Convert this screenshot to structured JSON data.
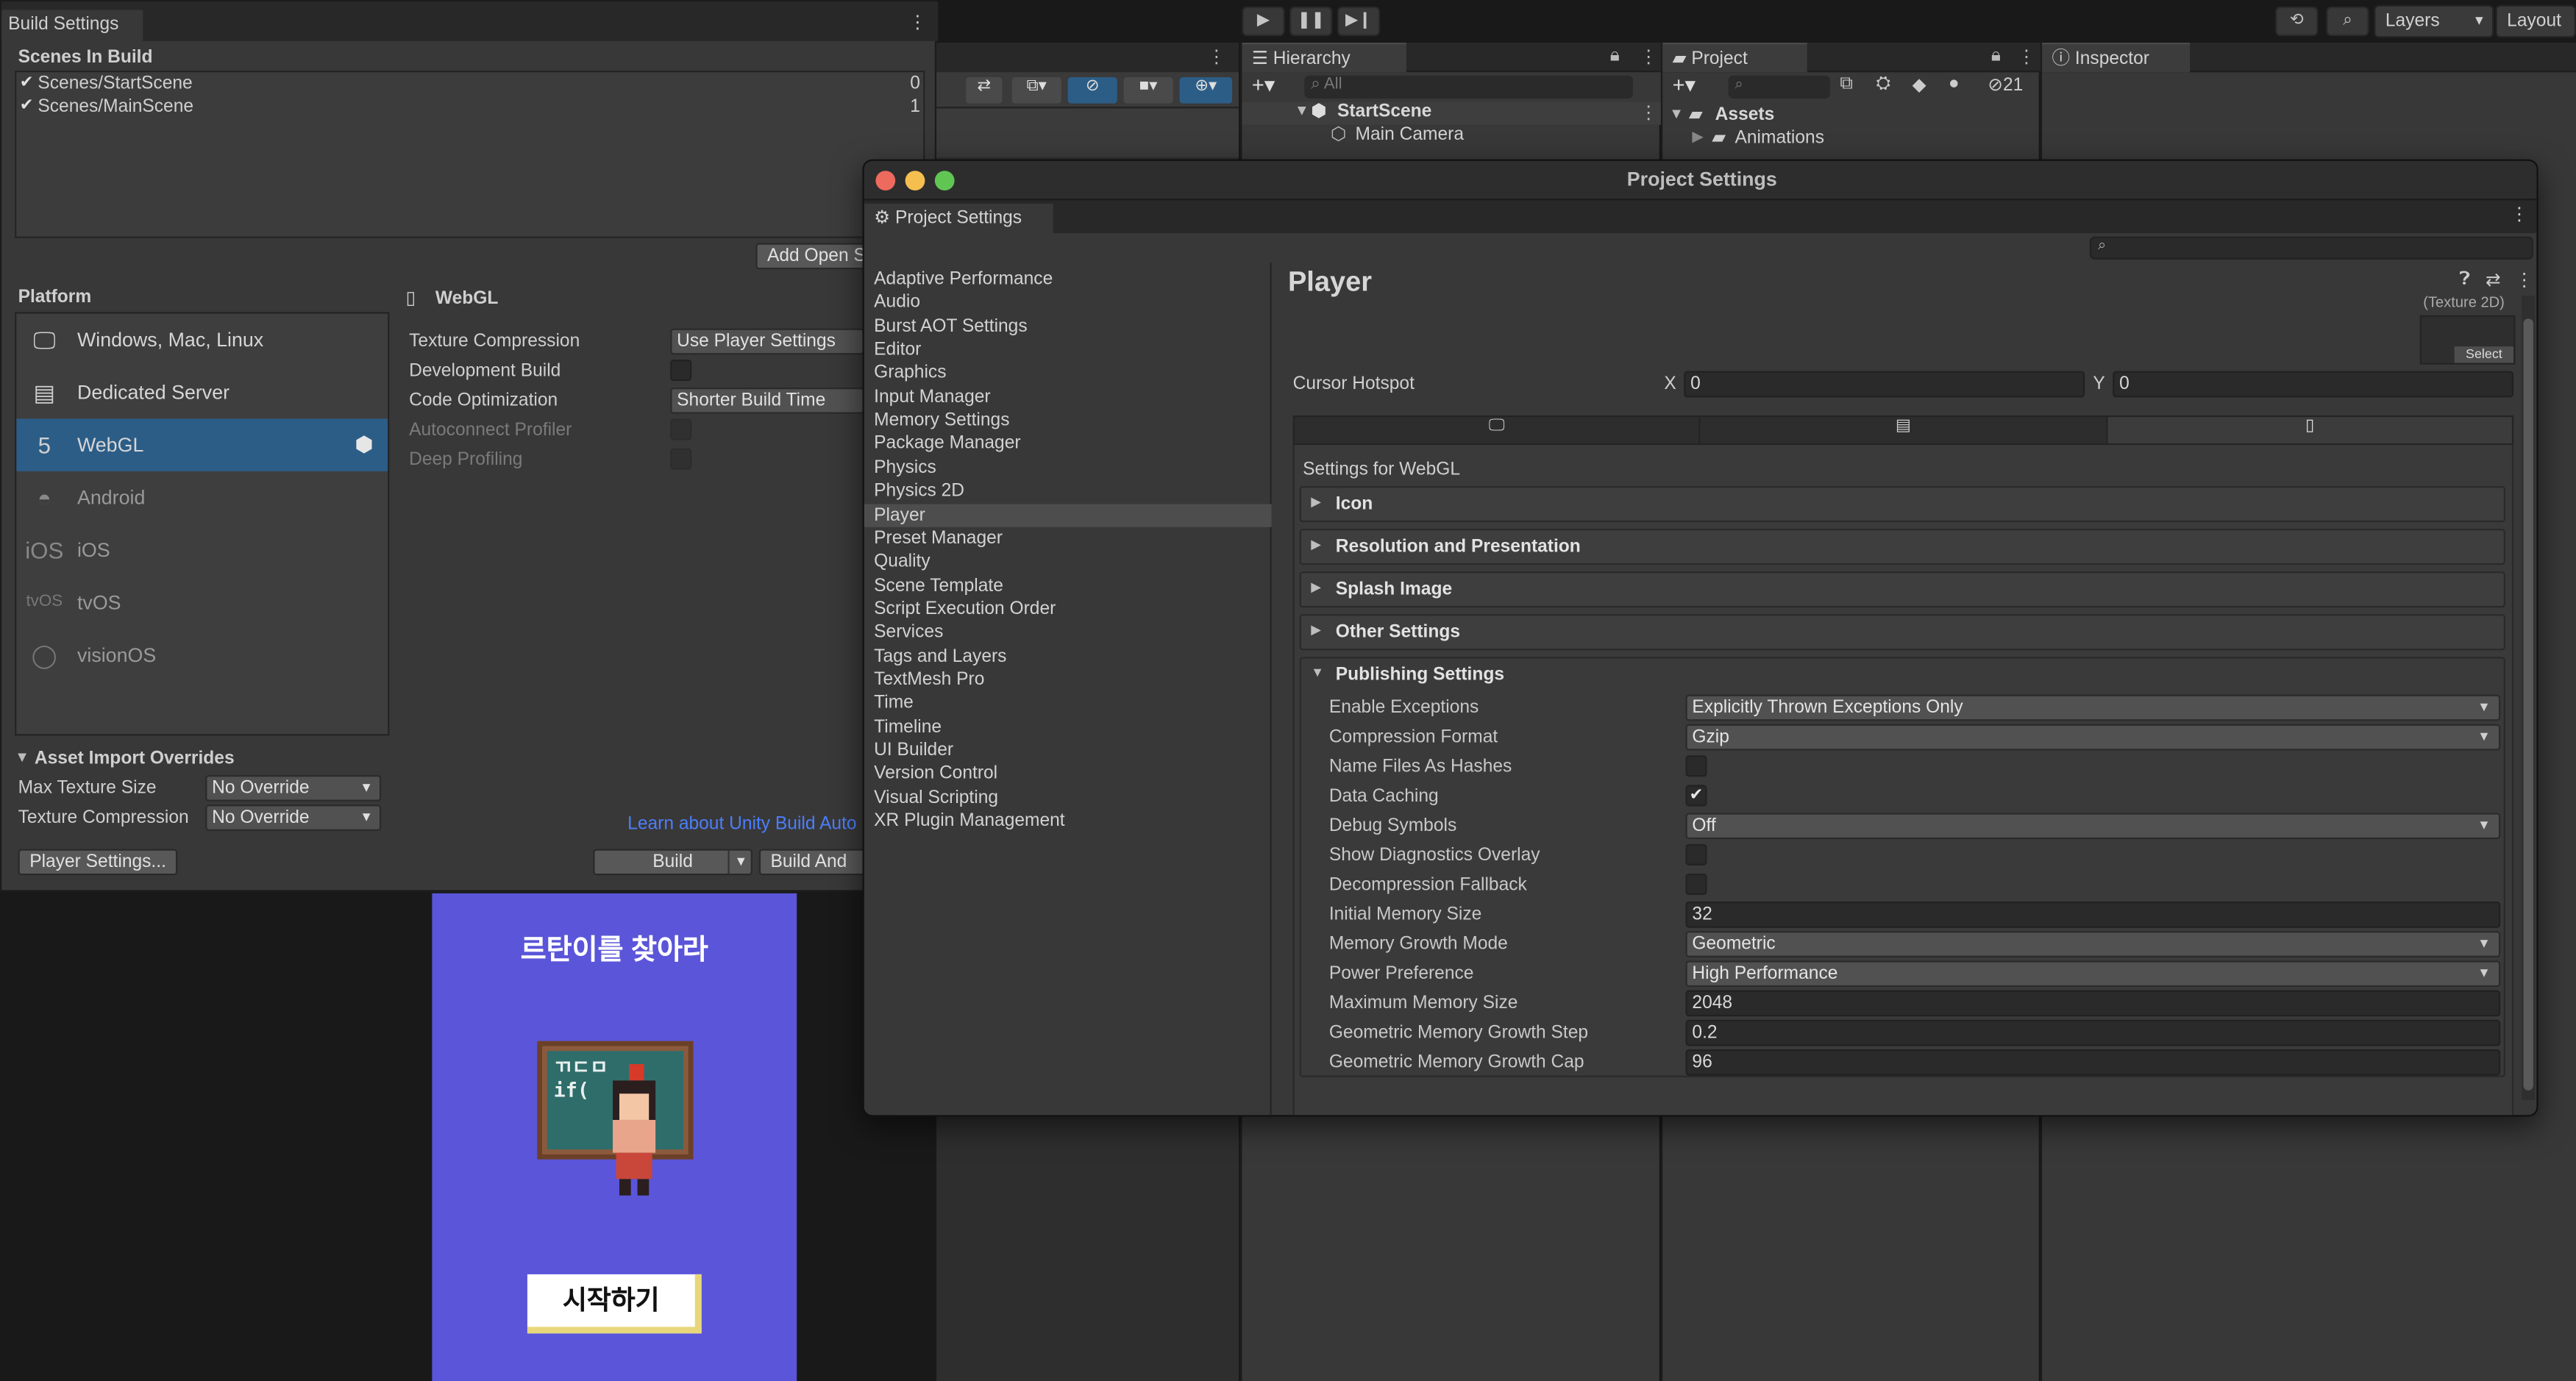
{
  "toolbar": {
    "layers_label": "Layers",
    "layout_label": "Layout"
  },
  "hierarchy": {
    "tab_label": "Hierarchy",
    "search_placeholder": "All",
    "scene_name": "StartScene",
    "items": [
      "Main Camera"
    ]
  },
  "project": {
    "tab_label": "Project",
    "hidden_count": "21",
    "assets_label": "Assets",
    "folders": [
      "Animations"
    ]
  },
  "inspector": {
    "tab_label": "Inspector"
  },
  "build_settings": {
    "tab_label": "Build Settings",
    "scenes_header": "Scenes In Build",
    "scenes": [
      {
        "name": "Scenes/StartScene",
        "index": "0"
      },
      {
        "name": "Scenes/MainScene",
        "index": "1"
      }
    ],
    "add_open_scenes": "Add Open S",
    "platform_header": "Platform",
    "platforms": [
      {
        "label": "Windows, Mac, Linux",
        "icon": "monitor-icon"
      },
      {
        "label": "Dedicated Server",
        "icon": "server-icon"
      },
      {
        "label": "WebGL",
        "icon": "html5-icon"
      },
      {
        "label": "Android",
        "icon": "android-icon"
      },
      {
        "label": "iOS",
        "icon": "ios-icon"
      },
      {
        "label": "tvOS",
        "icon": "tvos-icon"
      },
      {
        "label": "visionOS",
        "icon": "visionos-icon"
      }
    ],
    "selected_platform": "WebGL",
    "webgl_header": "WebGL",
    "options": {
      "texture_compression_label": "Texture Compression",
      "texture_compression_value": "Use Player Settings",
      "development_build_label": "Development Build",
      "code_optimization_label": "Code Optimization",
      "code_optimization_value": "Shorter Build Time",
      "autoconnect_profiler_label": "Autoconnect Profiler",
      "deep_profiling_label": "Deep Profiling"
    },
    "asset_import_overrides": "Asset Import Overrides",
    "max_texture_size_label": "Max Texture Size",
    "max_texture_size_value": "No Override",
    "texture_compression_label": "Texture Compression",
    "texture_compression_value": "No Override",
    "learn_link": "Learn about Unity Build Auto",
    "player_settings_button": "Player Settings...",
    "build_button": "Build",
    "build_and_run_button": "Build And"
  },
  "game_preview": {
    "title": "르탄이를 찾아라",
    "start_button": "시작하기",
    "board_text": "ㄲㄷㅁ\nif("
  },
  "project_settings": {
    "window_title": "Project Settings",
    "tab_label": "Project Settings",
    "nav": [
      "Adaptive Performance",
      "Audio",
      "Burst AOT Settings",
      "Editor",
      "Graphics",
      "Input Manager",
      "Memory Settings",
      "Package Manager",
      "Physics",
      "Physics 2D",
      "Player",
      "Preset Manager",
      "Quality",
      "Scene Template",
      "Script Execution Order",
      "Services",
      "Tags and Layers",
      "TextMesh Pro",
      "Time",
      "Timeline",
      "UI Builder",
      "Version Control",
      "Visual Scripting",
      "XR Plugin Management"
    ],
    "selected_nav": "Player",
    "player_title": "Player",
    "texture_2d_label": "(Texture 2D)",
    "select_label": "Select",
    "cursor_hotspot_label": "Cursor Hotspot",
    "cursor_x_label": "X",
    "cursor_x_value": "0",
    "cursor_y_label": "Y",
    "cursor_y_value": "0",
    "platform_tabs": [
      "monitor-icon",
      "server-icon",
      "html5-icon"
    ],
    "settings_for": "Settings for WebGL",
    "sections": [
      "Icon",
      "Resolution and Presentation",
      "Splash Image",
      "Other Settings"
    ],
    "publishing_header": "Publishing Settings",
    "publishing": {
      "enable_exceptions_label": "Enable Exceptions",
      "enable_exceptions_value": "Explicitly Thrown Exceptions Only",
      "compression_format_label": "Compression Format",
      "compression_format_value": "Gzip",
      "name_files_as_hashes_label": "Name Files As Hashes",
      "name_files_as_hashes_checked": false,
      "data_caching_label": "Data Caching",
      "data_caching_checked": true,
      "debug_symbols_label": "Debug Symbols",
      "debug_symbols_value": "Off",
      "show_diagnostics_overlay_label": "Show Diagnostics Overlay",
      "decompression_fallback_label": "Decompression Fallback",
      "initial_memory_size_label": "Initial Memory Size",
      "initial_memory_size_value": "32",
      "memory_growth_mode_label": "Memory Growth Mode",
      "memory_growth_mode_value": "Geometric",
      "power_preference_label": "Power Preference",
      "power_preference_value": "High Performance",
      "maximum_memory_size_label": "Maximum Memory Size",
      "maximum_memory_size_value": "2048",
      "geometric_growth_step_label": "Geometric Memory Growth Step",
      "geometric_growth_step_value": "0.2",
      "geometric_growth_cap_label": "Geometric Memory Growth Cap",
      "geometric_growth_cap_value": "96"
    }
  },
  "colors": {
    "accent_selection": "#2c5d87",
    "game_background": "#5a55d9",
    "link": "#4c7efc"
  }
}
